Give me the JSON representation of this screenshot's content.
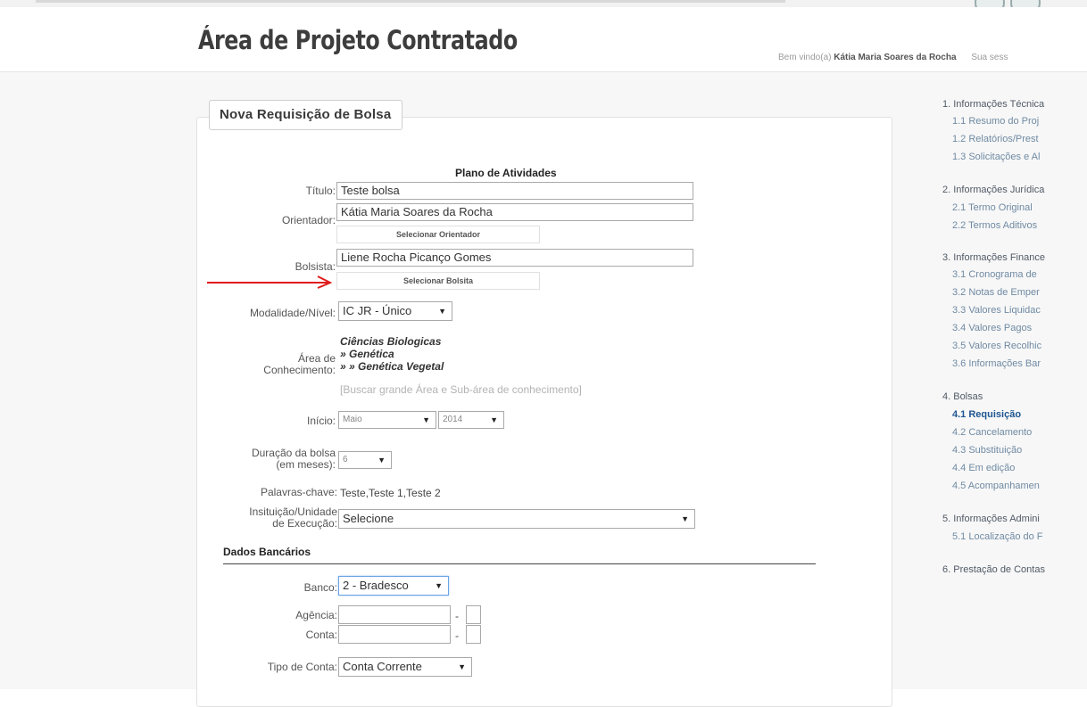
{
  "header": {
    "title": "Área de Projeto Contratado",
    "welcome_prefix": "Bem vindo(a)",
    "user_name": "Kátia Maria Soares da Rocha",
    "session_text": "Sua sess"
  },
  "form": {
    "legend": "Nova Requisição de Bolsa",
    "plan_title": "Plano de Atividades",
    "titulo_label": "Título:",
    "titulo_value": "Teste bolsa",
    "orientador_label": "Orientador:",
    "orientador_value": "Kátia Maria Soares da Rocha",
    "select_orientador": "Selecionar Orientador",
    "bolsista_label": "Bolsista:",
    "bolsista_value": "Liene Rocha Picanço Gomes",
    "select_bolsista": "Selecionar Bolsita",
    "modalidade_label": "Modalidade/Nível:",
    "modalidade_value": "IC JR - Único",
    "area_label_1": "Área de",
    "area_label_2": "Conhecimento:",
    "area_line1": "Ciências Biologicas",
    "area_line2": "» Genética",
    "area_line3": "» » Genética Vegetal",
    "area_search": "[Buscar grande Área e Sub-área de conhecimento]",
    "inicio_label": "Início:",
    "inicio_month": "Maio",
    "inicio_year": "2014",
    "duracao_label_1": "Duração da bolsa",
    "duracao_label_2": "(em meses):",
    "duracao_value": "6",
    "palavras_label": "Palavras-chave:",
    "palavras_value": "Teste,Teste 1,Teste 2",
    "instituicao_label_1": "Insituição/Unidade",
    "instituicao_label_2": "de Execução:",
    "instituicao_value": "Selecione",
    "dados_bancarios": "Dados Bancários",
    "banco_label": "Banco:",
    "banco_value": "2 - Bradesco",
    "agencia_label": "Agência:",
    "agencia_value": "",
    "conta_label": "Conta:",
    "conta_value": "",
    "dash": "-",
    "tipo_conta_label": "Tipo de Conta:",
    "tipo_conta_value": "Conta Corrente"
  },
  "sidebar": {
    "groups": [
      {
        "label": "1. Informações Técnica",
        "items": [
          "1.1 Resumo do Proj",
          "1.2 Relatórios/Prest",
          "1.3 Solicitações e Al"
        ]
      },
      {
        "label": "2. Informações Jurídica",
        "items": [
          "2.1 Termo Original",
          "2.2 Termos Aditivos"
        ]
      },
      {
        "label": "3. Informações Finance",
        "items": [
          "3.1 Cronograma de",
          "3.2 Notas de Emper",
          "3.3 Valores Liquidac",
          "3.4 Valores Pagos",
          "3.5 Valores Recolhic",
          "3.6 Informações Bar"
        ]
      },
      {
        "label": "4. Bolsas",
        "items": [
          "4.1 Requisição",
          "4.2 Cancelamento",
          "4.3 Substituição",
          "4.4 Em edição",
          "4.5 Acompanhamen"
        ]
      },
      {
        "label": "5. Informações Admini",
        "items": [
          "5.1 Localização do F"
        ]
      },
      {
        "label": "6. Prestação de Contas",
        "items": []
      }
    ]
  },
  "colors": {
    "arrow": "#e11b1b",
    "active_link": "#1e5591",
    "link": "#6f8aa3"
  }
}
